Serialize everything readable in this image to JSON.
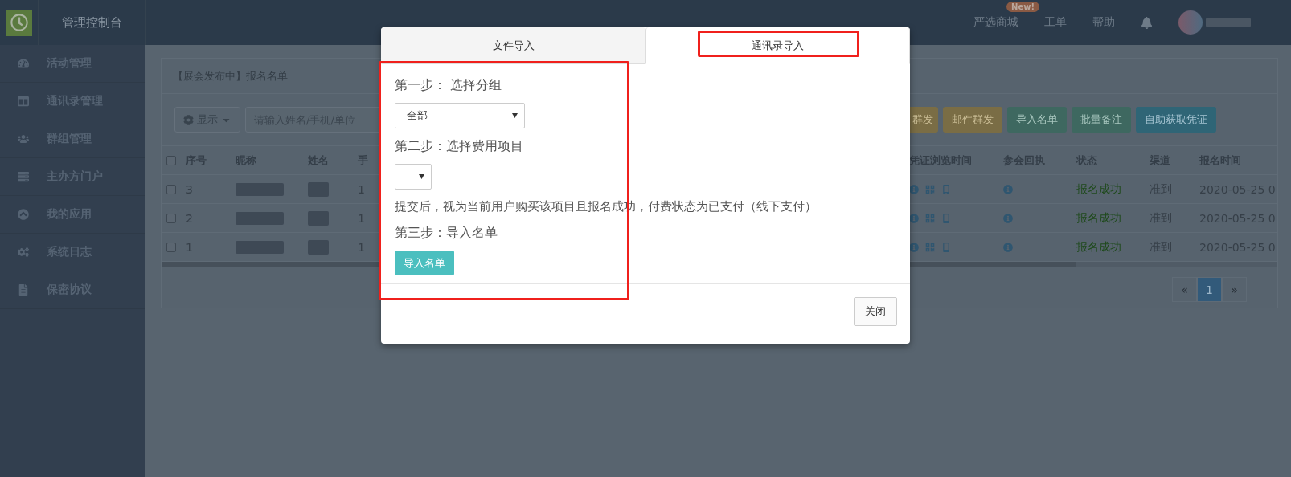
{
  "header": {
    "title": "管理控制台",
    "nav": [
      {
        "label": "严选商城",
        "badge": "New!"
      },
      {
        "label": "工单"
      },
      {
        "label": "帮助"
      }
    ]
  },
  "sidebar": {
    "items": [
      {
        "label": "活动管理"
      },
      {
        "label": "通讯录管理"
      },
      {
        "label": "群组管理"
      },
      {
        "label": "主办方门户"
      },
      {
        "label": "我的应用"
      },
      {
        "label": "系统日志"
      },
      {
        "label": "保密协议"
      }
    ]
  },
  "panel": {
    "title": "【展会发布中】报名名单",
    "display_button": "显示",
    "search": {
      "placeholder": "请输入姓名/手机/单位"
    },
    "actions": [
      {
        "label": "群发",
        "kind": "warning"
      },
      {
        "label": "邮件群发",
        "kind": "warning"
      },
      {
        "label": "导入名单",
        "kind": "success"
      },
      {
        "label": "批量备注",
        "kind": "success"
      },
      {
        "label": "自助获取凭证",
        "kind": "info"
      }
    ],
    "table": {
      "header_checked": false,
      "left_columns": [
        "序号",
        "昵称",
        "姓名",
        "手"
      ],
      "right_columns": [
        "凭证浏览时间",
        "参会回执",
        "状态",
        "渠道",
        "报名时间"
      ],
      "rows": [
        {
          "checked": false,
          "index": "3",
          "column_4": "1",
          "status": "报名成功",
          "channel": "准到",
          "time": "2020-05-25 0"
        },
        {
          "checked": false,
          "index": "2",
          "column_4": "1",
          "status": "报名成功",
          "channel": "准到",
          "time": "2020-05-25 0"
        },
        {
          "checked": false,
          "index": "1",
          "column_4": "1",
          "status": "报名成功",
          "channel": "准到",
          "time": "2020-05-25 0"
        }
      ]
    },
    "pagination": {
      "prev": "«",
      "pages": [
        {
          "label": "1",
          "selected": true
        }
      ],
      "next": "»"
    }
  },
  "dialog": {
    "tabs": [
      {
        "label": "文件导入",
        "selected": false,
        "highlighted": false
      },
      {
        "label": "通讯录导入",
        "selected": true,
        "highlighted": true
      }
    ],
    "body": {
      "highlighted": true,
      "items": [
        {
          "kind": "step",
          "text": "第一步： 选择分组"
        },
        {
          "kind": "select",
          "value": "全部"
        },
        {
          "kind": "step",
          "text": "第二步：选择费用项目"
        },
        {
          "kind": "select"
        },
        {
          "kind": "note",
          "text": "提交后，视为当前用户购买该项目且报名成功，付费状态为已支付（线下支付）"
        },
        {
          "kind": "step",
          "text": "第三步：导入名单"
        },
        {
          "kind": "button",
          "label": "导入名单"
        }
      ]
    },
    "close_button": "关闭"
  }
}
